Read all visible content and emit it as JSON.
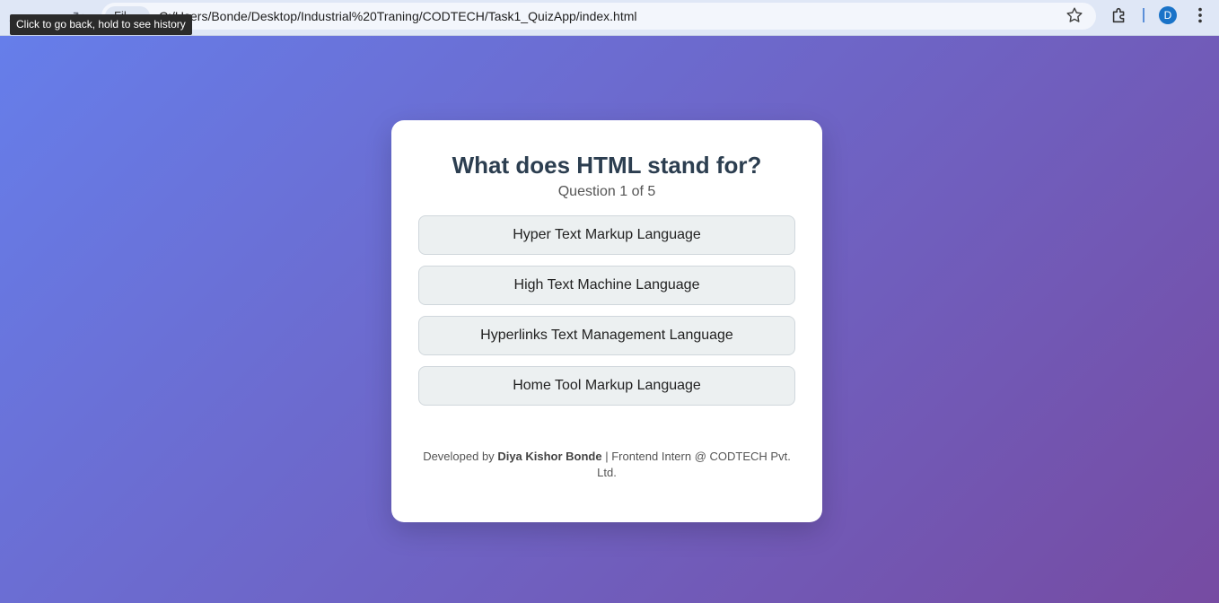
{
  "browser": {
    "site_chip": "Fil",
    "url": "C:/Users/Bonde/Desktop/Industrial%20Traning/CODTECH/Task1_QuizApp/index.html",
    "tooltip": "Click to go back, hold to see history",
    "profile_initial": "D"
  },
  "quiz": {
    "question": "What does HTML stand for?",
    "counter": "Question 1 of 5",
    "options": [
      "Hyper Text Markup Language",
      "High Text Machine Language",
      "Hyperlinks Text Management Language",
      "Home Tool Markup Language"
    ]
  },
  "footer": {
    "prefix": "Developed by ",
    "name": "Diya Kishor Bonde",
    "suffix": " | Frontend Intern @ CODTECH Pvt. Ltd."
  },
  "colors": {
    "gradient_start": "#667eea",
    "gradient_end": "#764ba2",
    "question_text": "#2c3e50",
    "option_bg": "#ecf0f1"
  }
}
